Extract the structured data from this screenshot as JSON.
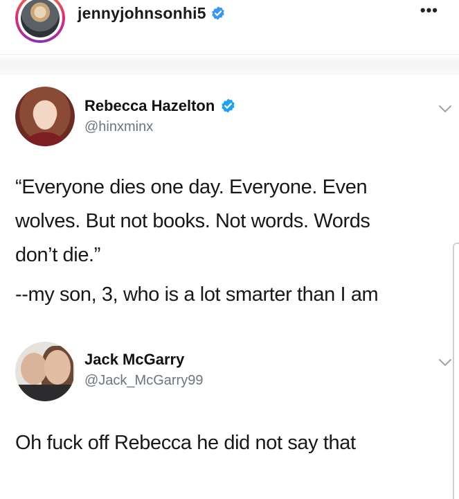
{
  "post": {
    "username": "jennyjohnsonhi5",
    "more_label": "•••"
  },
  "tweets": [
    {
      "name": "Rebecca Hazelton",
      "handle": "@hinxminx",
      "verified": true,
      "lines": [
        "“Everyone dies one day. Everyone. Even",
        "wolves. But not books. Not words. Words",
        "don’t die.”",
        "--my son, 3, who is a lot smarter than I am"
      ]
    },
    {
      "name": "Jack McGarry",
      "handle": "@Jack_McGarry99",
      "verified": false,
      "lines": [
        "Oh fuck off Rebecca he did not say that"
      ]
    }
  ],
  "colors": {
    "verified_blue": "#1da1f2",
    "handle_gray": "#6b7580",
    "ig_gradient": [
      "#f58529",
      "#dd2a7b",
      "#8134af"
    ]
  },
  "icons": {
    "ig_verified": "verified-badge-icon",
    "tweet_verified": "verified-badge-icon",
    "menu": "more-dots-icon",
    "tweet_menu": "chevron-down-icon"
  }
}
